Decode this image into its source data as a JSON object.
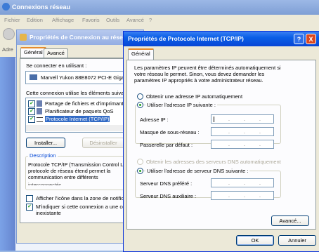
{
  "bg_window": {
    "title": "Connexions réseau",
    "menu": [
      "Fichier",
      "Edition",
      "Affichage",
      "Favoris",
      "Outils",
      "Avancé",
      "?"
    ],
    "address_label": "Adre"
  },
  "conn_dialog": {
    "title": "Propriétés de Connexion au rése",
    "tabs": [
      "Général",
      "Avancé"
    ],
    "connect_using_label": "Se connecter en utilisant :",
    "adapter": "Marvell Yukon 88E8072 PCI-E Gigal",
    "elements_label": "Cette connexion utilise les éléments suivan",
    "components": [
      {
        "label": "Partage de fichiers et d'imprimante",
        "checked": true
      },
      {
        "label": "Planificateur de paquets QoS",
        "checked": true
      },
      {
        "label": "Protocole Internet (TCP/IP)",
        "checked": true
      }
    ],
    "install_button": "Installer...",
    "uninstall_button": "Désinstaller",
    "description_title": "Description",
    "description_text": "Protocole TCP/IP (Transmission Control Le protocole de réseau étend permet la communication entre différents",
    "description_cut": "interconnectés",
    "show_icon_label": "Afficher l'icône dans la zone de notificat",
    "notify_label": "M'indiquer si cette connexion a une cor",
    "notify_label2": "inexistante"
  },
  "tcpip_dialog": {
    "title": "Propriétés de Protocole Internet (TCP/IP)",
    "help_btn": "?",
    "close_btn": "X",
    "tab": "Général",
    "intro": "Les paramètres IP peuvent être déterminés automatiquement si votre réseau le permet. Sinon, vous devez demander les paramètres IP appropriés à votre administrateur réseau.",
    "ip_auto": "Obtenir une adresse IP automatiquement",
    "ip_manual": "Utiliser l'adresse IP suivante :",
    "ip_fields": [
      "Adresse IP :",
      "Masque de sous-réseau :",
      "Passerelle par défaut :"
    ],
    "dns_auto": "Obtenir les adresses des serveurs DNS automatiquement",
    "dns_manual": "Utiliser l'adresse de serveur DNS suivante :",
    "dns_fields": [
      "Serveur DNS préféré :",
      "Serveur DNS auxiliaire :"
    ],
    "advanced_button": "Avancé...",
    "ok_button": "OK",
    "cancel_button": "Annuler"
  }
}
